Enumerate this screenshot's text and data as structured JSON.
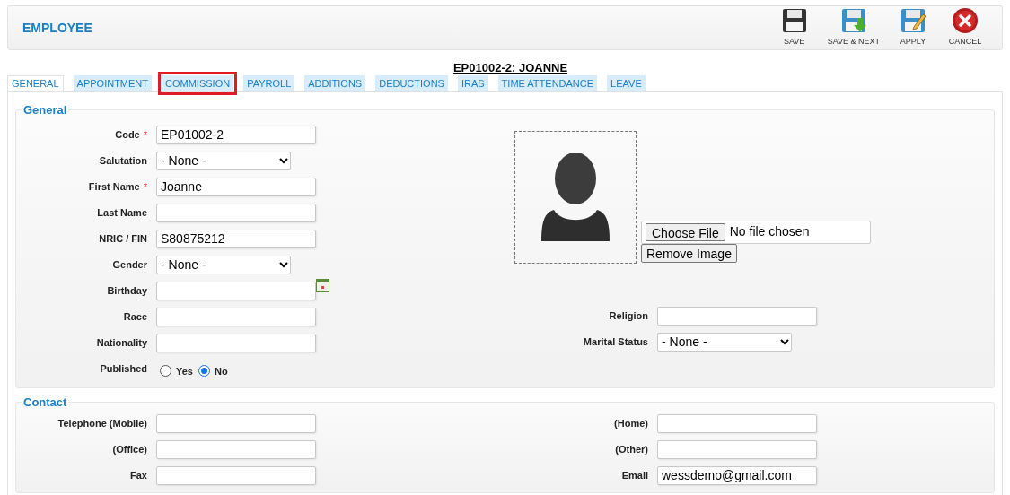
{
  "header": {
    "title": "EMPLOYEE",
    "actions": [
      {
        "kind": "save",
        "label": "SAVE"
      },
      {
        "kind": "save_next",
        "label": "SAVE & NEXT"
      },
      {
        "kind": "apply",
        "label": "APPLY"
      },
      {
        "kind": "cancel",
        "label": "CANCEL"
      }
    ]
  },
  "record_title": "EP01002-2: JOANNE",
  "tabs": [
    {
      "label": "GENERAL",
      "selected": true,
      "highlighted": false
    },
    {
      "label": "APPOINTMENT",
      "selected": false,
      "highlighted": false
    },
    {
      "label": "COMMISSION",
      "selected": false,
      "highlighted": true
    },
    {
      "label": "PAYROLL",
      "selected": false,
      "highlighted": false
    },
    {
      "label": "ADDITIONS",
      "selected": false,
      "highlighted": false
    },
    {
      "label": "DEDUCTIONS",
      "selected": false,
      "highlighted": false
    },
    {
      "label": "IRAS",
      "selected": false,
      "highlighted": false
    },
    {
      "label": "TIME ATTENDANCE",
      "selected": false,
      "highlighted": false
    },
    {
      "label": "LEAVE",
      "selected": false,
      "highlighted": false
    }
  ],
  "general": {
    "legend": "General",
    "fields_left": [
      {
        "kind": "text",
        "label": "Code",
        "required_mark": "*",
        "value": "EP01002-2"
      },
      {
        "kind": "select",
        "label": "Salutation",
        "value": "- None -"
      },
      {
        "kind": "text",
        "label": "First Name",
        "required_mark": "*",
        "value": "Joanne"
      },
      {
        "kind": "text",
        "label": "Last Name"
      },
      {
        "kind": "text",
        "label": "NRIC / FIN",
        "value": "S80875212"
      },
      {
        "kind": "select",
        "label": "Gender",
        "value": "- None -"
      },
      {
        "kind": "date",
        "label": "Birthday"
      },
      {
        "kind": "text",
        "label": "Race"
      },
      {
        "kind": "text",
        "label": "Nationality"
      },
      {
        "kind": "radio",
        "label": "Published",
        "options": [
          {
            "label": "Yes",
            "selected": false
          },
          {
            "label": "No",
            "selected": true
          }
        ]
      }
    ],
    "photo": {
      "choose_button": "Choose File",
      "file_status": "No file chosen",
      "remove_button": "Remove Image"
    },
    "fields_right": [
      {
        "kind": "text",
        "label": "Religion"
      },
      {
        "kind": "select",
        "label": "Marital Status",
        "value": "- None -"
      }
    ]
  },
  "contact": {
    "legend": "Contact",
    "fields_left": [
      {
        "label": "Telephone (Mobile)"
      },
      {
        "label": "(Office)"
      },
      {
        "label": "Fax"
      }
    ],
    "fields_right": [
      {
        "label": "(Home)"
      },
      {
        "label": "(Other)"
      },
      {
        "label": "Email",
        "value": "wessdemo@gmail.com"
      }
    ]
  }
}
